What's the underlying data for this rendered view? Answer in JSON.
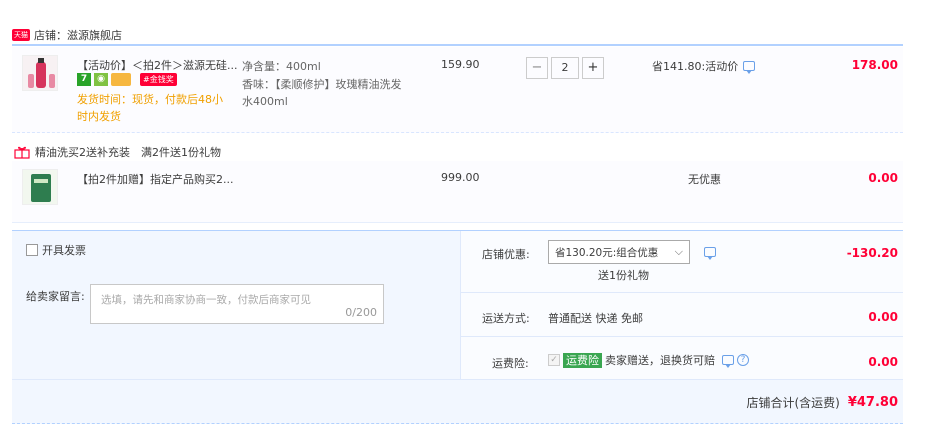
{
  "shop": {
    "badge": "天猫",
    "label": "店铺：滋源旗舰店"
  },
  "item1": {
    "title": "【活动价】＜拍2件＞滋源无硅...",
    "ship_time": "发货时间：现货，付款后48小时内发货",
    "badge_hot": "#金钱奖",
    "badge_seven": "7",
    "spec_volume": "净含量：400ml",
    "spec_scent": "香味：【柔顺修护】玫瑰精油洗发水400ml",
    "price": "159.90",
    "qty_minus": "−",
    "qty_value": "2",
    "qty_plus": "+",
    "discount": "省141.80:活动价",
    "subtotal": "178.00"
  },
  "promo": {
    "label": "精油洗买2送补充装",
    "rule": "满2件送1份礼物"
  },
  "item2": {
    "title": "【拍2件加赠】指定产品购买2...",
    "price": "999.00",
    "discount": "无优惠",
    "subtotal": "0.00"
  },
  "invoice": {
    "label": "开具发票"
  },
  "message": {
    "label": "给卖家留言:",
    "placeholder": "选填，请先和商家协商一致，付款后商家可见",
    "counter": "0/200"
  },
  "shop_discount": {
    "label": "店铺优惠:",
    "select_value": "省130.20元:组合优惠",
    "gift": "送1份礼物",
    "amount": "-130.20"
  },
  "shipping": {
    "label": "运送方式:",
    "value": "普通配送 快递 免邮",
    "amount": "0.00"
  },
  "insurance": {
    "label": "运费险:",
    "tag": "运费险",
    "text": "卖家赠送，退换货可赔",
    "amount": "0.00"
  },
  "total": {
    "label": "店铺合计(含运费)",
    "amount": "¥47.80"
  },
  "colors": {
    "accent_red": "#ff0036",
    "border_blue": "#b2d1ff",
    "ship_orange": "#f0a000"
  }
}
